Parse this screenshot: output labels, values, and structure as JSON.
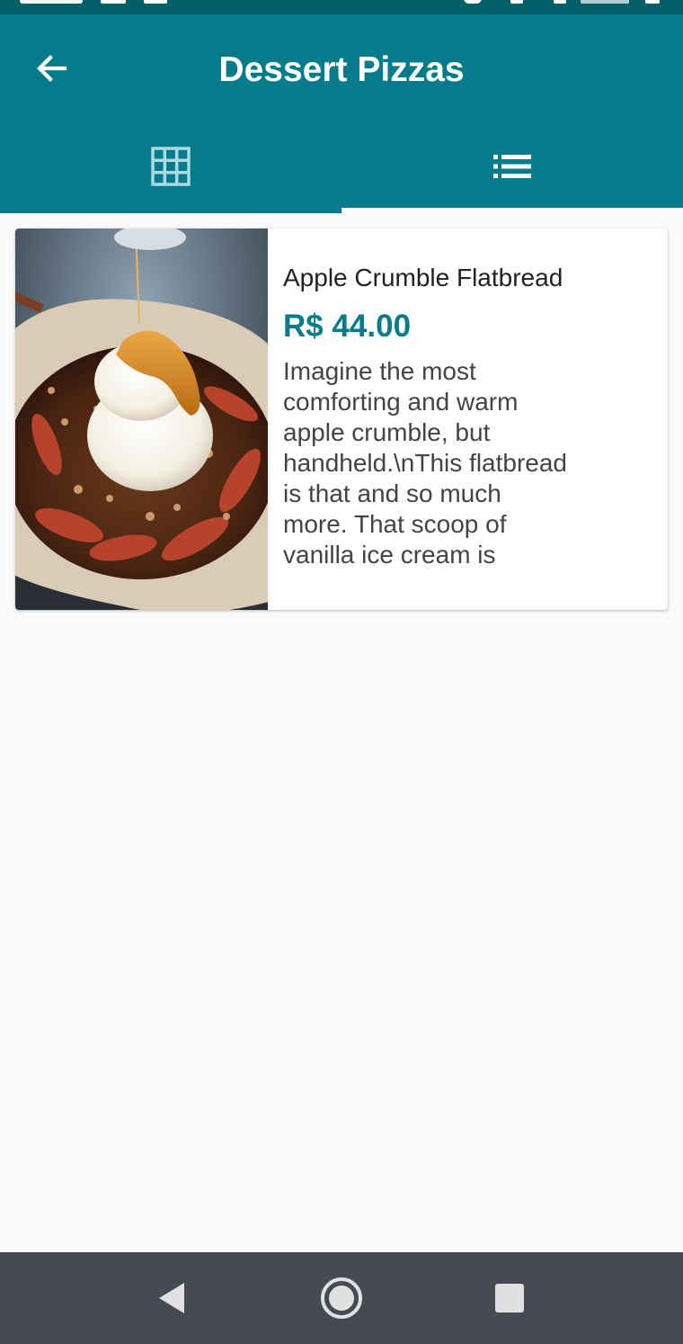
{
  "status_bar": {},
  "app_bar": {
    "title": "Dessert Pizzas",
    "back_icon": "arrow-back-icon",
    "color": "#057b8c"
  },
  "tabs": [
    {
      "icon": "grid-view-icon",
      "selected": false
    },
    {
      "icon": "list-view-icon",
      "selected": true
    }
  ],
  "products": [
    {
      "name": "Apple Crumble Flatbread",
      "price": "R$ 44.00",
      "description": "Imagine the most comforting and warm apple crumble, but handheld.\\nThis flatbread is that and so much more. That scoop of vanilla ice cream is",
      "image_icon": "dessert-photo"
    }
  ],
  "nav_bar": {
    "back_icon": "triangle-back-icon",
    "home_icon": "circle-home-icon",
    "recents_icon": "square-recents-icon"
  }
}
